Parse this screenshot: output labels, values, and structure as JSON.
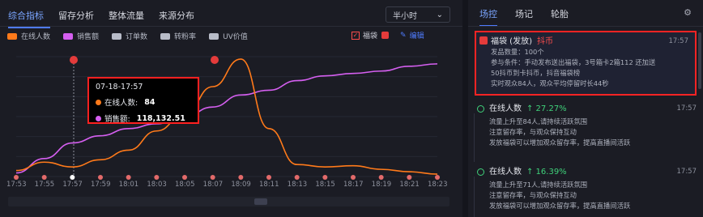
{
  "tabs": [
    {
      "label": "综合指标",
      "active": true
    },
    {
      "label": "留存分析",
      "active": false
    },
    {
      "label": "整体流量",
      "active": false
    },
    {
      "label": "来源分布",
      "active": false
    }
  ],
  "interval_select": {
    "value": "半小时"
  },
  "legend": [
    {
      "label": "在线人数",
      "color": "#ff7a1a"
    },
    {
      "label": "销售额",
      "color": "#d55ff0"
    },
    {
      "label": "订单数",
      "color": "#b8bcc8"
    },
    {
      "label": "转粉率",
      "color": "#b8bcc8"
    },
    {
      "label": "UV价值",
      "color": "#b8bcc8"
    }
  ],
  "actions": {
    "fudai_label": "福袋",
    "edit_label": "编辑"
  },
  "tooltip": {
    "time": "07-18-17:57",
    "online_label": "在线人数:",
    "online_value": "84",
    "sales_label": "销售额:",
    "sales_value": "118,132.51"
  },
  "chart_data": {
    "type": "line",
    "x": [
      "17:53",
      "17:55",
      "17:57",
      "17:59",
      "18:01",
      "18:03",
      "18:05",
      "18:07",
      "18:09",
      "18:11",
      "18:13",
      "18:15",
      "18:17",
      "18:19",
      "18:21",
      "18:23"
    ],
    "series": [
      {
        "name": "在线人数",
        "color": "#ff7a1a",
        "values": [
          5,
          12,
          8,
          14,
          22,
          38,
          52,
          75,
          98,
          40,
          10,
          8,
          9,
          6,
          4,
          2
        ]
      },
      {
        "name": "销售额",
        "color": "#d55ff0",
        "values": [
          3,
          15,
          28,
          34,
          40,
          44,
          50,
          58,
          68,
          72,
          80,
          84,
          86,
          88,
          92,
          94
        ]
      }
    ],
    "ylim": [
      0,
      100
    ],
    "grid": true
  },
  "right_tabs": [
    {
      "label": "场控",
      "active": true
    },
    {
      "label": "场记",
      "active": false
    },
    {
      "label": "轮胎",
      "active": false
    }
  ],
  "event1": {
    "title": "福袋 (发放)",
    "tag": "抖币",
    "time": "17:57",
    "lines": [
      "发品数量：100个",
      "参与条件：手动发布送出福袋，3号箱卡2箱112 还加送",
      "50抖币到卡抖币，抖音福袋榜",
      "实时观众84人，观众平均停留时长44秒"
    ]
  },
  "event2": {
    "title": "在线人数",
    "change": "↑ 27.27%",
    "time": "17:57",
    "lines": [
      "流量上升至84人,请持续活跃氛围",
      "注意留存率，与观众保持互动",
      "发放福袋可以增加观众留存率，提高直播间活跃"
    ]
  },
  "event3": {
    "title": "在线人数",
    "change": "↑ 16.39%",
    "time": "17:57",
    "lines": [
      "流量上升至71人,请持续活跃氛围",
      "注意留存率，与观众保持互动",
      "发放福袋可以增加观众留存率，提高直播间活跃"
    ]
  }
}
